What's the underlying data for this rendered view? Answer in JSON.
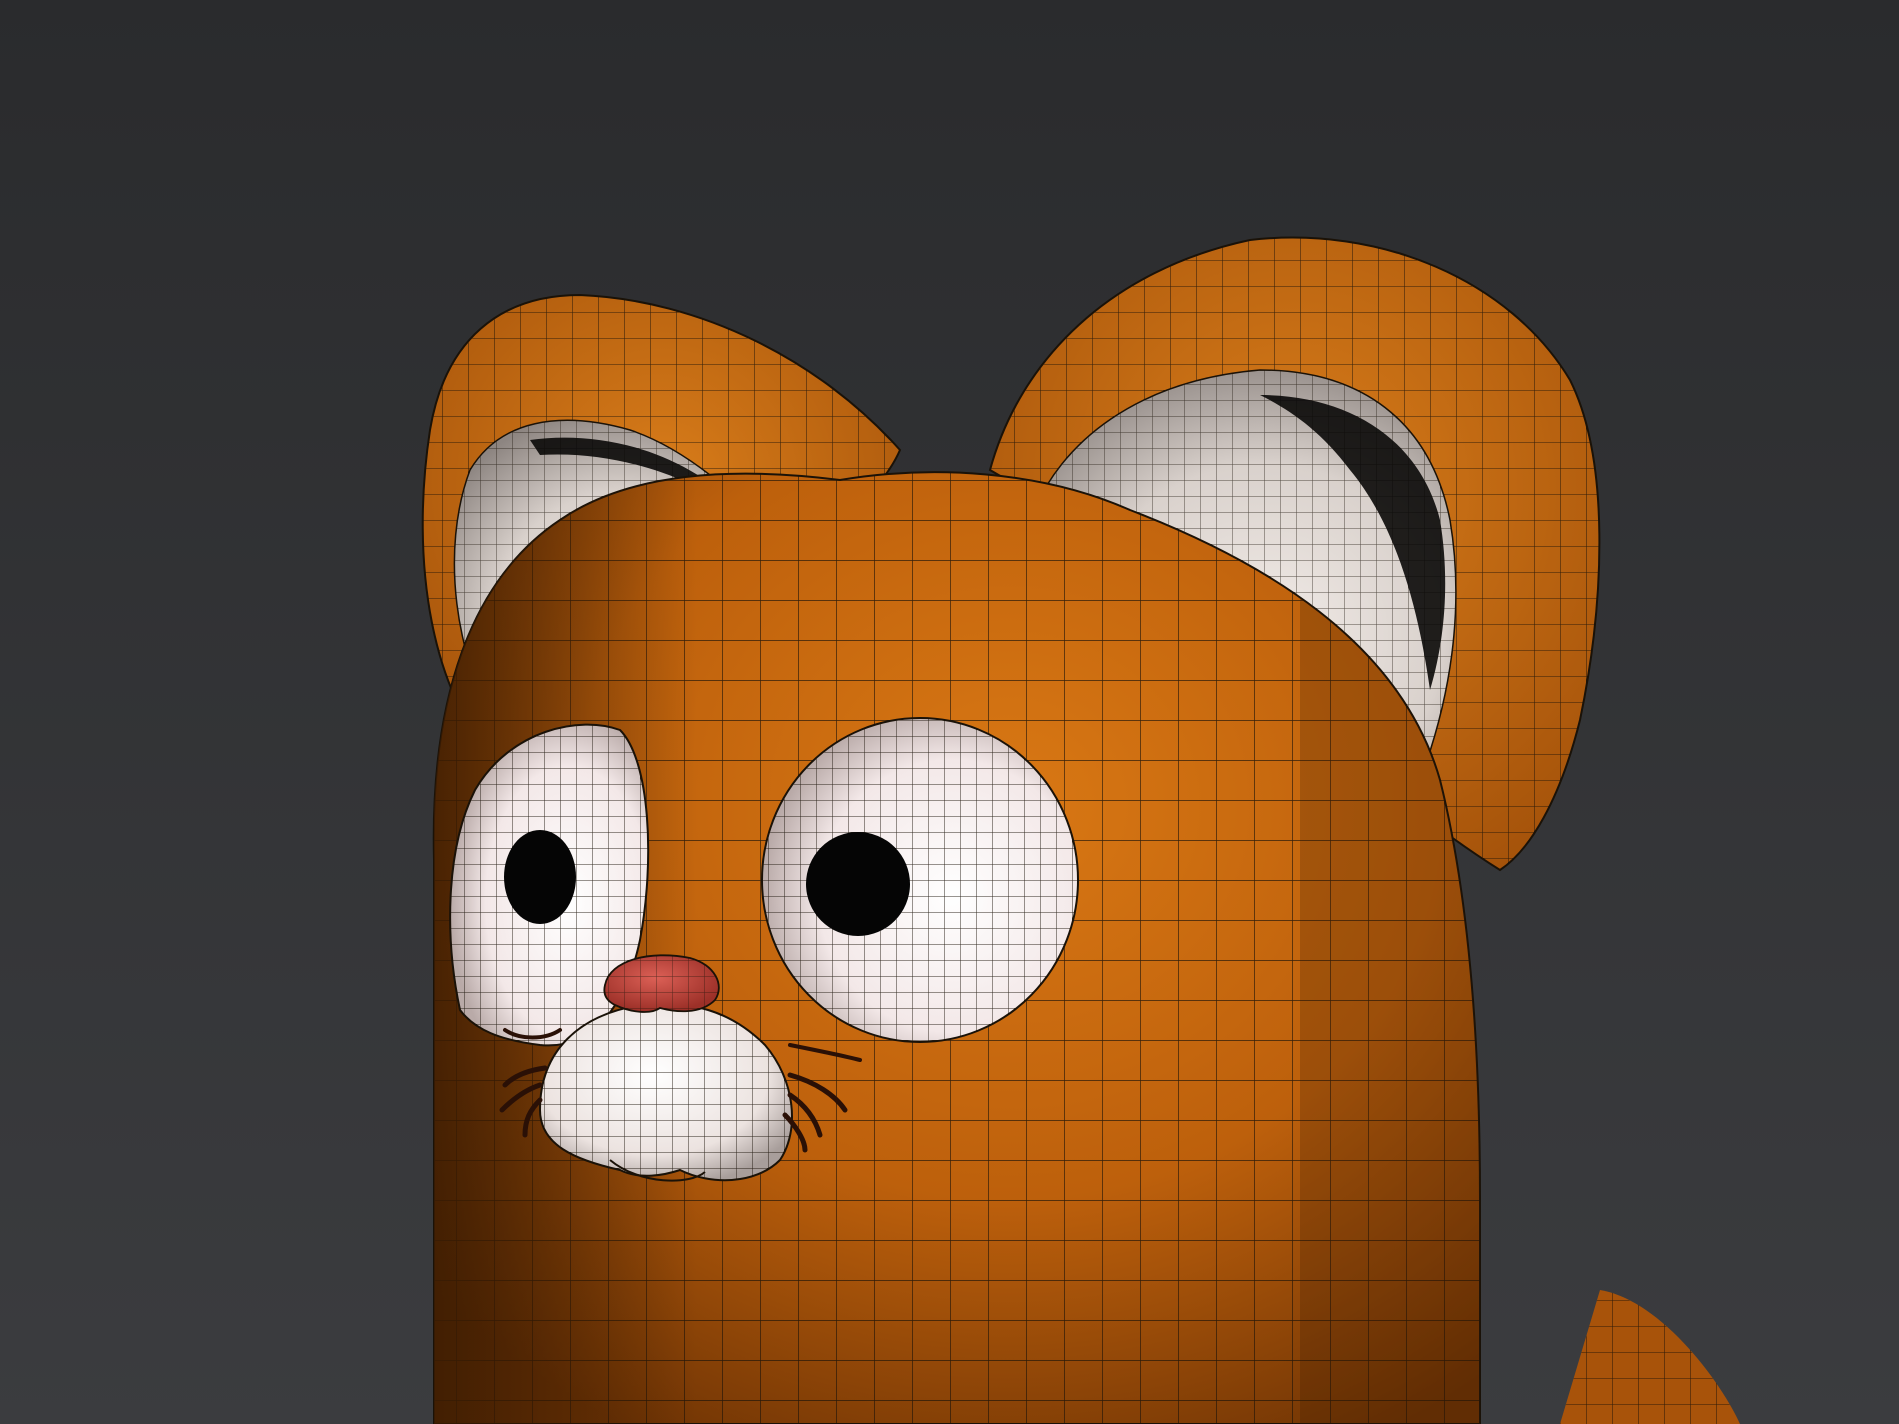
{
  "viewport": {
    "background_top": "#2a2b2d",
    "background_bottom": "#3a3b3e",
    "wireframe_color": "#1a1208"
  },
  "model": {
    "body_color": "#c7670f",
    "body_shadow": "#7a3a05",
    "ear_inner_color": "#e8e2de",
    "eye_white": "#f4eeee",
    "pupil_color": "#050505",
    "nose_color": "#c0493f",
    "muzzle_color": "#f0e8e6",
    "whisker_color": "#2a1006"
  }
}
